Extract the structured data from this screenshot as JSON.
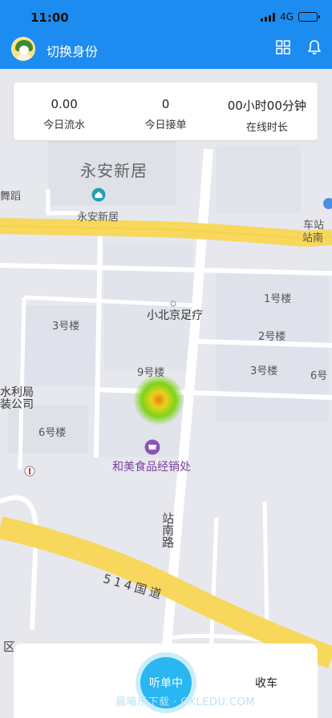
{
  "status_bar": {
    "time": "11:00",
    "network": "4G"
  },
  "header": {
    "title": "切换身份"
  },
  "stats": [
    {
      "value": "0.00",
      "label": "今日流水"
    },
    {
      "value": "0",
      "label": "今日接单"
    },
    {
      "value": "00小时00分钟",
      "label": "在线时长"
    }
  ],
  "map": {
    "labels": {
      "area": "永安新居",
      "poi_home": "永安新居",
      "dance": "舞蹈",
      "station_1": "车站",
      "station_2": "站南",
      "b3": "3号楼",
      "b1": "1号楼",
      "b2": "2号楼",
      "b3b": "3号楼",
      "b9": "9号楼",
      "b6": "6号楼",
      "b6b": "6号",
      "foot": "小北京足疗",
      "water_1": "水利局",
      "water_2": "装公司",
      "shop": "和美食品经销处",
      "road_south": "站南路",
      "road_national": "514国道",
      "district": "区"
    }
  },
  "bottom": {
    "listen_label": "听单中",
    "close_label": "收车",
    "watermark": "晨曦乐下载 · CXLEDU.COM"
  }
}
